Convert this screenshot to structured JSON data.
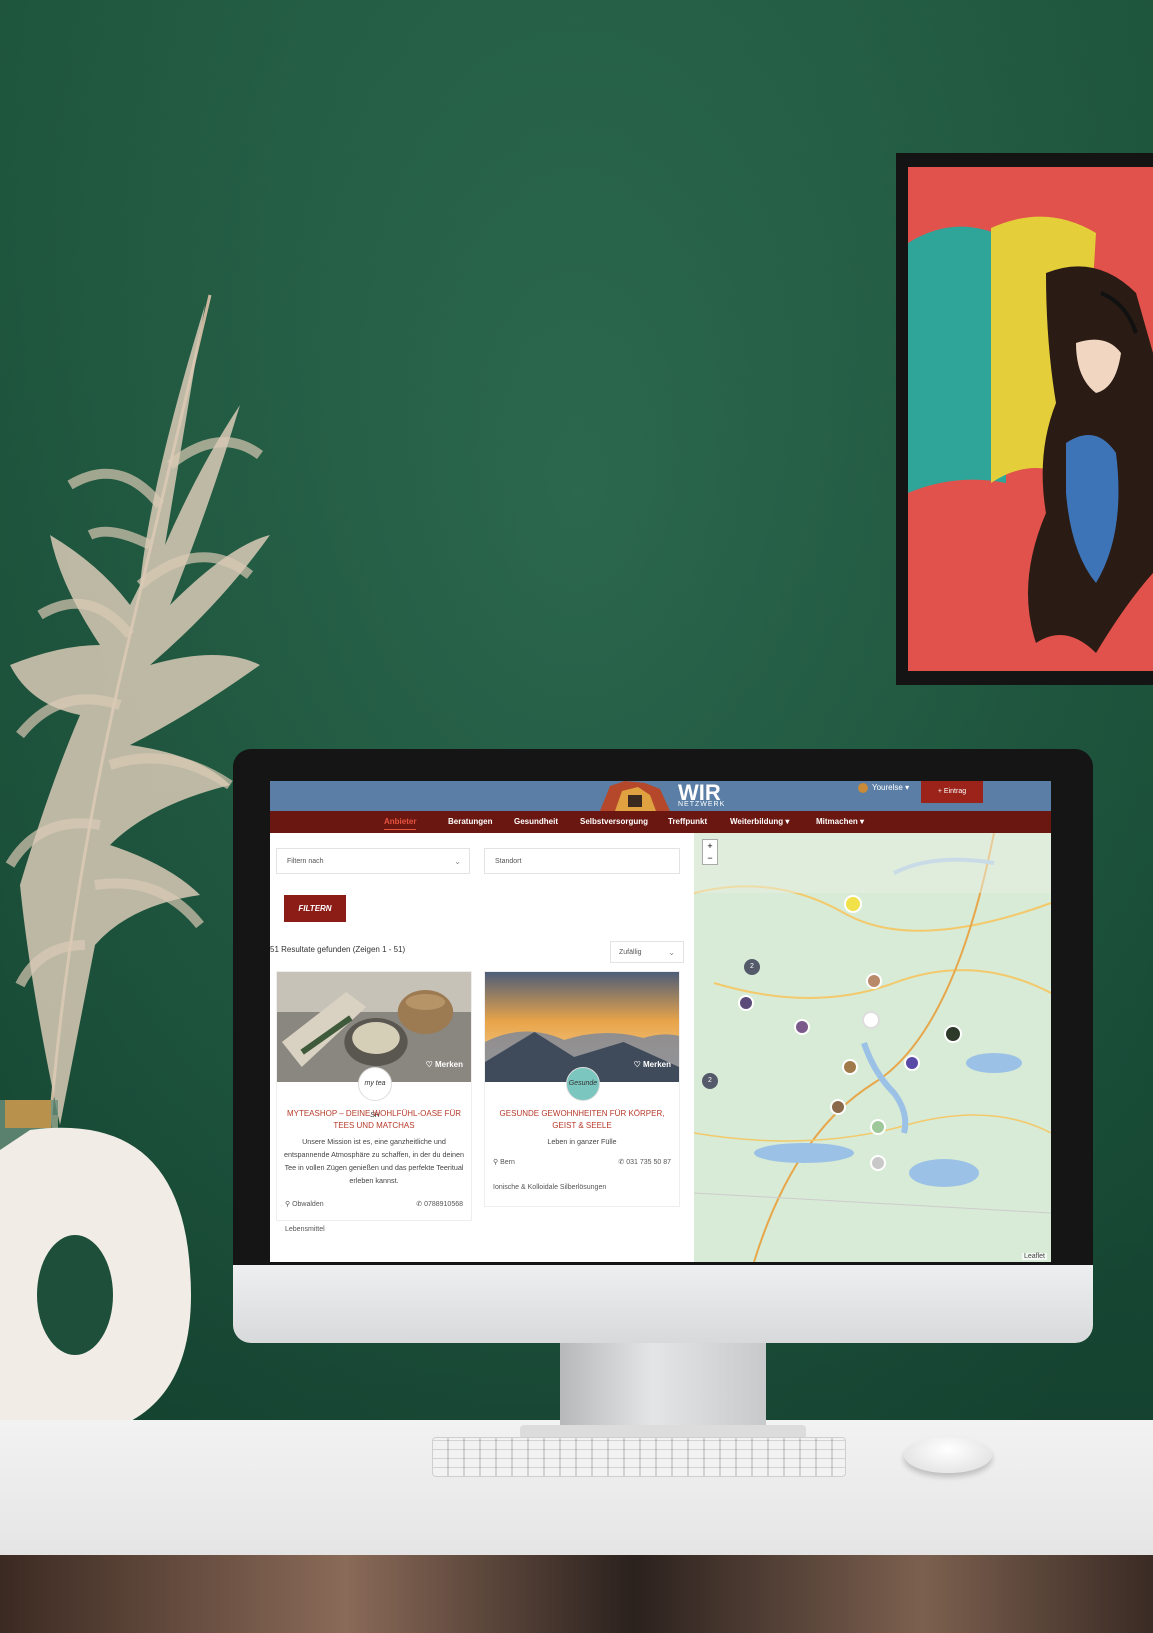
{
  "site": {
    "logo_text": "WIR",
    "logo_subtitle": "NETZWERK",
    "user_name": "Yourelse",
    "login_label": "+ Eintrag"
  },
  "nav": {
    "items": [
      {
        "label": "Anbieter",
        "active": true
      },
      {
        "label": "Beratungen",
        "active": false
      },
      {
        "label": "Gesundheit",
        "active": false
      },
      {
        "label": "Selbstversorgung",
        "active": false
      },
      {
        "label": "Treffpunkt",
        "active": false
      },
      {
        "label": "Weiterbildung ▾",
        "active": false
      },
      {
        "label": "Mitmachen ▾",
        "active": false
      }
    ]
  },
  "filters": {
    "filter_by_placeholder": "Filtern nach",
    "location_placeholder": "Standort",
    "filter_button": "FILTERN"
  },
  "results": {
    "count_text": "51 Resultate gefunden (Zeigen 1 - 51)",
    "sort_value": "Zufällig"
  },
  "cards": [
    {
      "title": "MYTEASHOP – DEINE WOHLFÜHL-OASE FÜR TEES UND MATCHAS",
      "description": "Unsere Mission ist es, eine ganzheitliche und entspannende Atmosphäre zu schaffen, in der du deinen Tee in vollen Zügen genießen und das perfekte Teeritual erleben kannst.",
      "location": "Obwalden",
      "phone": "0788910568",
      "category": "Lebensmittel",
      "save_label": "♡ Merken",
      "logo_text": "my tea SH"
    },
    {
      "title": "GESUNDE GEWOHNHEITEN FÜR KÖRPER, GEIST & SEELE",
      "description": "Leben in ganzer Fülle",
      "location": "Bern",
      "phone": "031 735 50 87",
      "category": "Ionische & Kolloidale Silberlösungen",
      "save_label": "♡ Merken",
      "logo_text": "Gesunde"
    }
  ],
  "map": {
    "zoom_in": "+",
    "zoom_out": "−",
    "attribution": "Leaflet",
    "cluster_labels": [
      "2",
      "2"
    ]
  },
  "colors": {
    "wall": "#1f5e43",
    "topbar": "#5a7ea5",
    "navbar": "#6b1711",
    "accent": "#9b2319",
    "title_red": "#b73a2a"
  }
}
